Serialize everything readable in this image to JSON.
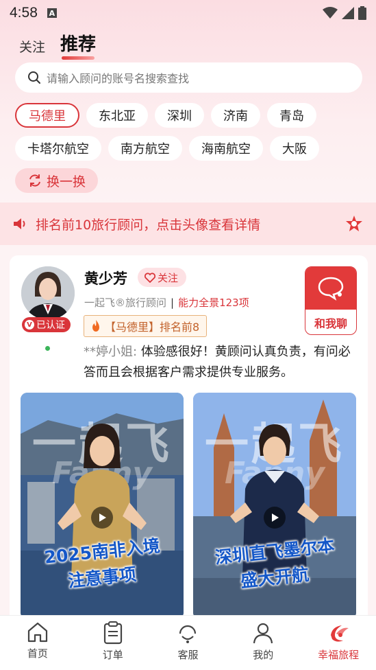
{
  "status_bar": {
    "time": "4:58",
    "notification_letter": "A"
  },
  "tabs": [
    {
      "label": "关注"
    },
    {
      "label": "推荐"
    }
  ],
  "search": {
    "placeholder": "请输入顾问的账号名搜索查找"
  },
  "city_chips": {
    "row1": [
      "马德里",
      "东北亚",
      "深圳",
      "济南",
      "青岛"
    ],
    "row2": [
      "卡塔尔航空",
      "南方航空",
      "海南航空",
      "大阪"
    ],
    "selected": "马德里"
  },
  "refresh_button": {
    "label": "换一换"
  },
  "notice": {
    "text": "排名前10旅行顾问，点击头像查看详情"
  },
  "consultant": {
    "name": "黄少芳",
    "follow_label": "关注",
    "verified_label": "已认证",
    "title": "一起飞®旅行顾问",
    "separator": "|",
    "ability": "能力全景123项",
    "rank": "【马德里】排名前8",
    "chat_label": "和我聊",
    "review_author": "**婷小姐:",
    "review_text": " 体验感很好！黄顾问认真负责，有问必答而且会根据客户需求提供专业服务。"
  },
  "videos": [
    {
      "watermark": "一起飞",
      "watermark_sub": "Fanny",
      "caption_line1": "2025南非入境",
      "caption_line2": "注意事项"
    },
    {
      "watermark": "一起飞",
      "watermark_sub": "Fanny",
      "caption_line1": "深圳直飞墨尔本",
      "caption_line2": "盛大开航"
    }
  ],
  "bottom_nav": [
    {
      "label": "首页",
      "icon": "home-icon"
    },
    {
      "label": "订单",
      "icon": "order-icon"
    },
    {
      "label": "客服",
      "icon": "service-icon"
    },
    {
      "label": "我的",
      "icon": "profile-icon"
    },
    {
      "label": "幸福旅程",
      "icon": "brand-logo-icon"
    }
  ],
  "colors": {
    "accent": "#d9353a",
    "chip_bg": "#ffffff",
    "rank_border": "#e8b27a"
  }
}
